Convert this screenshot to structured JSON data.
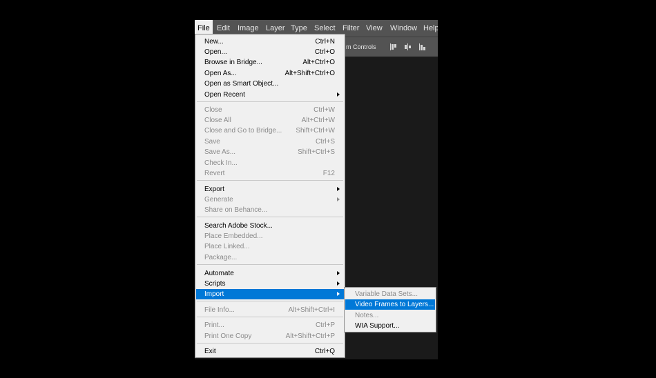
{
  "menubar": {
    "items": [
      "File",
      "Edit",
      "Image",
      "Layer",
      "Type",
      "Select",
      "Filter",
      "View",
      "Window",
      "Help"
    ],
    "active": "File"
  },
  "optionsbar": {
    "transform_controls_label": "m Controls",
    "icons": [
      "align-top-edges-icon",
      "align-vertical-centers-icon",
      "align-bottom-edges-icon"
    ]
  },
  "file_menu": {
    "items": [
      {
        "label": "New...",
        "shortcut": "Ctrl+N",
        "enabled": true,
        "submenu": false
      },
      {
        "label": "Open...",
        "shortcut": "Ctrl+O",
        "enabled": true,
        "submenu": false
      },
      {
        "label": "Browse in Bridge...",
        "shortcut": "Alt+Ctrl+O",
        "enabled": true,
        "submenu": false
      },
      {
        "label": "Open As...",
        "shortcut": "Alt+Shift+Ctrl+O",
        "enabled": true,
        "submenu": false
      },
      {
        "label": "Open as Smart Object...",
        "shortcut": "",
        "enabled": true,
        "submenu": false
      },
      {
        "label": "Open Recent",
        "shortcut": "",
        "enabled": true,
        "submenu": true
      },
      {
        "label": "Close",
        "shortcut": "Ctrl+W",
        "enabled": false,
        "submenu": false
      },
      {
        "label": "Close All",
        "shortcut": "Alt+Ctrl+W",
        "enabled": false,
        "submenu": false
      },
      {
        "label": "Close and Go to Bridge...",
        "shortcut": "Shift+Ctrl+W",
        "enabled": false,
        "submenu": false
      },
      {
        "label": "Save",
        "shortcut": "Ctrl+S",
        "enabled": false,
        "submenu": false
      },
      {
        "label": "Save As...",
        "shortcut": "Shift+Ctrl+S",
        "enabled": false,
        "submenu": false
      },
      {
        "label": "Check In...",
        "shortcut": "",
        "enabled": false,
        "submenu": false
      },
      {
        "label": "Revert",
        "shortcut": "F12",
        "enabled": false,
        "submenu": false
      },
      {
        "label": "Export",
        "shortcut": "",
        "enabled": true,
        "submenu": true
      },
      {
        "label": "Generate",
        "shortcut": "",
        "enabled": false,
        "submenu": true
      },
      {
        "label": "Share on Behance...",
        "shortcut": "",
        "enabled": false,
        "submenu": false
      },
      {
        "label": "Search Adobe Stock...",
        "shortcut": "",
        "enabled": true,
        "submenu": false
      },
      {
        "label": "Place Embedded...",
        "shortcut": "",
        "enabled": false,
        "submenu": false
      },
      {
        "label": "Place Linked...",
        "shortcut": "",
        "enabled": false,
        "submenu": false
      },
      {
        "label": "Package...",
        "shortcut": "",
        "enabled": false,
        "submenu": false
      },
      {
        "label": "Automate",
        "shortcut": "",
        "enabled": true,
        "submenu": true
      },
      {
        "label": "Scripts",
        "shortcut": "",
        "enabled": true,
        "submenu": true
      },
      {
        "label": "Import",
        "shortcut": "",
        "enabled": true,
        "submenu": true,
        "highlighted": true
      },
      {
        "label": "File Info...",
        "shortcut": "Alt+Shift+Ctrl+I",
        "enabled": false,
        "submenu": false
      },
      {
        "label": "Print...",
        "shortcut": "Ctrl+P",
        "enabled": false,
        "submenu": false
      },
      {
        "label": "Print One Copy",
        "shortcut": "Alt+Shift+Ctrl+P",
        "enabled": false,
        "submenu": false
      },
      {
        "label": "Exit",
        "shortcut": "Ctrl+Q",
        "enabled": true,
        "submenu": false
      }
    ]
  },
  "import_submenu": {
    "items": [
      {
        "label": "Variable Data Sets...",
        "enabled": false
      },
      {
        "label": "Video Frames to Layers...",
        "enabled": true,
        "highlighted": true
      },
      {
        "label": "Notes...",
        "enabled": false
      },
      {
        "label": "WIA Support...",
        "enabled": true
      }
    ]
  },
  "colors": {
    "menu_background": "#f0f0f0",
    "highlight": "#0078d7",
    "disabled_text": "#8a8a8a",
    "app_chrome": "#535353"
  }
}
